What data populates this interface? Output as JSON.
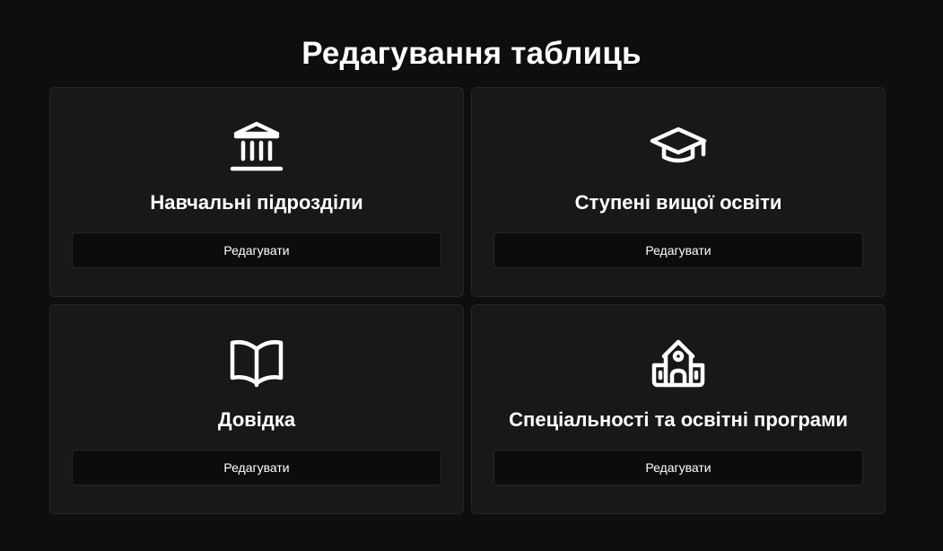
{
  "page": {
    "title": "Редагування таблиць"
  },
  "cards": [
    {
      "title": "Навчальні підрозділи",
      "icon": "bank-building-icon",
      "button_label": "Редагувати"
    },
    {
      "title": "Ступені вищої освіти",
      "icon": "graduation-cap-icon",
      "button_label": "Редагувати"
    },
    {
      "title": "Довідка",
      "icon": "open-book-icon",
      "button_label": "Редагувати"
    },
    {
      "title": "Спеціальності та освітні програми",
      "icon": "school-building-icon",
      "button_label": "Редагувати"
    }
  ],
  "colors": {
    "background": "#0e0e0e",
    "card": "#181818",
    "card_border": "#262626",
    "button": "#0c0c0c",
    "text": "#ffffff"
  }
}
